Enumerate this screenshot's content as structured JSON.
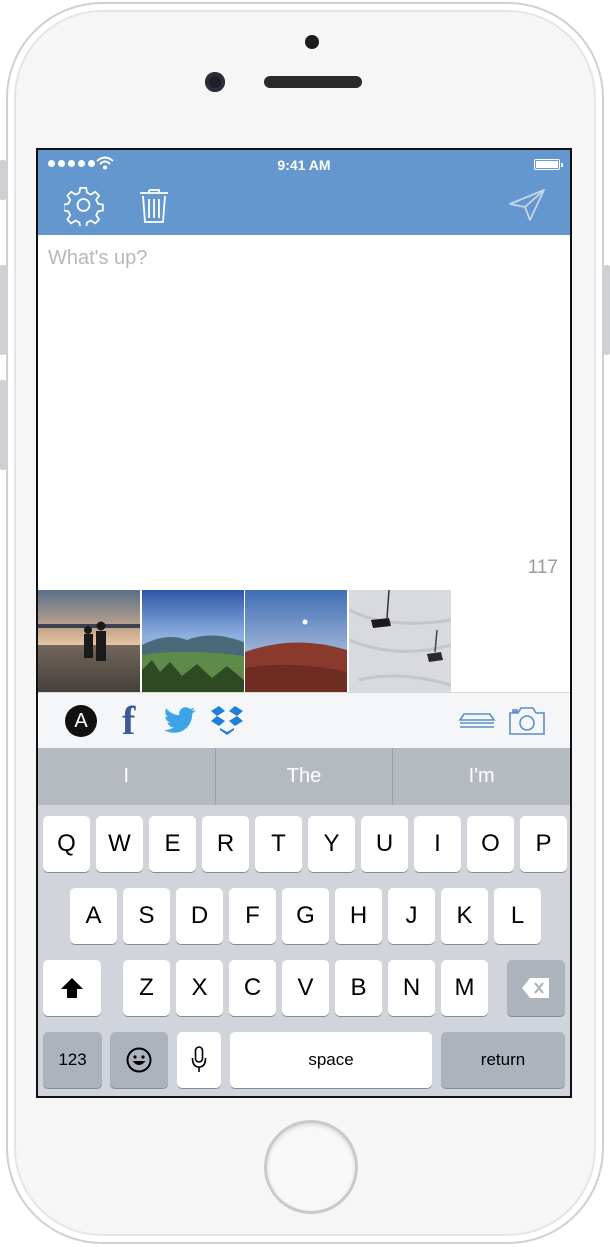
{
  "status_bar": {
    "time": "9:41 AM"
  },
  "navbar": {
    "settings_icon": "gear-icon",
    "trash_icon": "trash-icon",
    "send_icon": "paper-plane-icon"
  },
  "compose": {
    "placeholder": "What's up?",
    "value": "",
    "char_count": "117"
  },
  "photos": [
    {
      "name": "photo-lake-sunset"
    },
    {
      "name": "photo-mountain-valley"
    },
    {
      "name": "photo-red-hill-moon"
    },
    {
      "name": "photo-ski-lift-snow"
    }
  ],
  "share_bar": {
    "services": [
      "app-net-icon",
      "facebook-icon",
      "twitter-icon",
      "dropbox-icon"
    ],
    "tools": [
      "stack-icon",
      "camera-icon"
    ],
    "app_net_letter": "A",
    "facebook_letter": "f"
  },
  "keyboard": {
    "suggestions": [
      "I",
      "The",
      "I'm"
    ],
    "row1": [
      "Q",
      "W",
      "E",
      "R",
      "T",
      "Y",
      "U",
      "I",
      "O",
      "P"
    ],
    "row2": [
      "A",
      "S",
      "D",
      "F",
      "G",
      "H",
      "J",
      "K",
      "L"
    ],
    "row3": [
      "Z",
      "X",
      "C",
      "V",
      "B",
      "N",
      "M"
    ],
    "numbers_label": "123",
    "space_label": "space",
    "return_label": "return"
  },
  "colors": {
    "accent": "#6497cd",
    "keyboard_bg": "#d1d5db",
    "suggestion_bg": "#b5bac1"
  }
}
